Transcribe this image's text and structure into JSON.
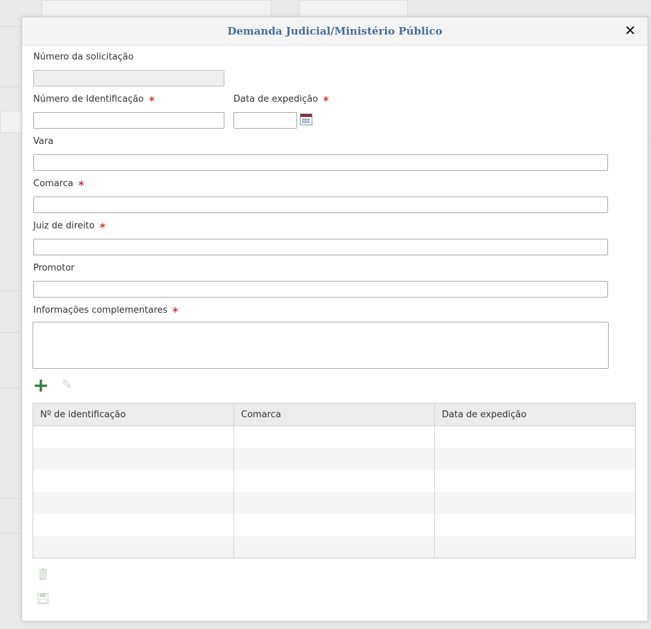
{
  "dialog": {
    "title": "Demanda Judicial/Ministério Público",
    "close_glyph": "✕"
  },
  "form": {
    "numero_solicitacao_label": "Número da solicitação",
    "numero_identificacao_label": "Número de Identificação",
    "data_expedicao_label": "Data de expedição",
    "vara_label": "Vara",
    "comarca_label": "Comarca",
    "juiz_label": "Juiz de direito",
    "promotor_label": "Promotor",
    "info_label": "Informações complementares",
    "required_mark": "∗"
  },
  "toolbar": {
    "add_icon": "plus-icon",
    "edit_icon": "pen-icon"
  },
  "table": {
    "columns": [
      "Nº de identificação",
      "Comarca",
      "Data de expedição"
    ]
  },
  "actions": {
    "delete_icon": "trash-icon",
    "save_icon": "floppy-icon"
  },
  "colors": {
    "title": "#4a6e94",
    "required": "#d0201c",
    "add": "#2f7d3a"
  }
}
